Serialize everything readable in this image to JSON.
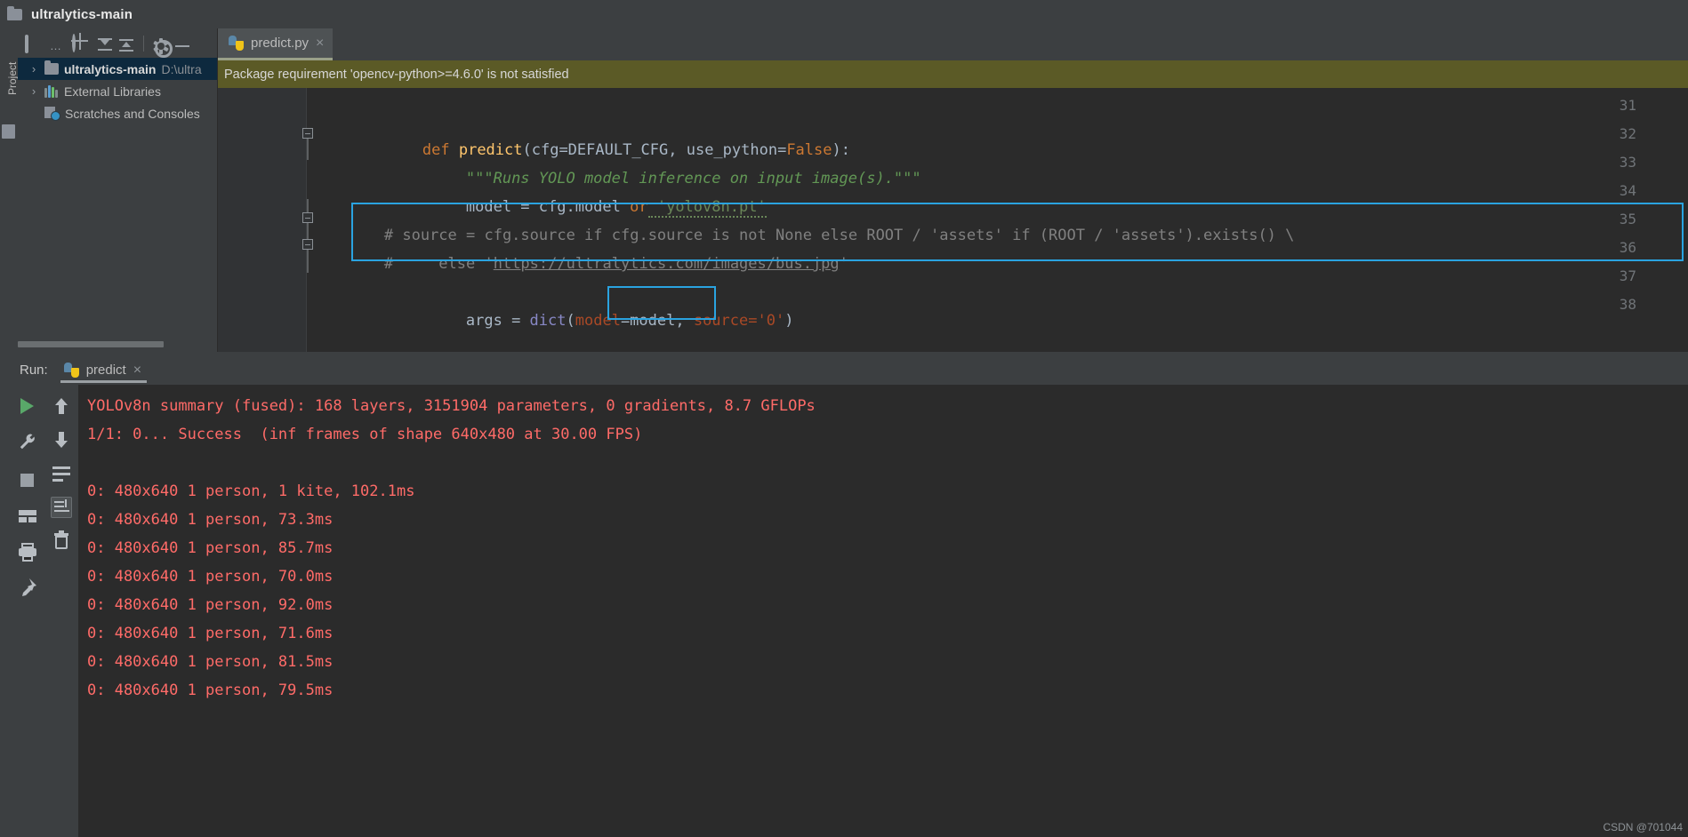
{
  "window": {
    "title": "ultralytics-main",
    "folder_icon": "folder-icon"
  },
  "left_strip": {
    "label": "Project"
  },
  "project_panel": {
    "toolbar": [
      {
        "name": "select-opened-file-icon",
        "label": "…"
      },
      {
        "name": "locate-target-icon",
        "label": ""
      },
      {
        "name": "expand-all-icon",
        "label": ""
      },
      {
        "name": "collapse-all-icon",
        "label": ""
      },
      {
        "name": "settings-gear-icon",
        "label": ""
      },
      {
        "name": "hide-panel-icon",
        "label": ""
      }
    ],
    "tree": [
      {
        "chevron": "›",
        "icon": "folder-icon",
        "label": "ultralytics-main",
        "path": "D:\\ultra",
        "selected": true
      },
      {
        "chevron": "›",
        "icon": "library-icon",
        "label": "External Libraries",
        "path": "",
        "selected": false
      },
      {
        "chevron": "",
        "icon": "scratches-icon",
        "label": "Scratches and Consoles",
        "path": "",
        "selected": false
      }
    ]
  },
  "editor": {
    "tab": {
      "label": "predict.py",
      "icon": "python-file-icon",
      "close": "×"
    },
    "warning": "Package requirement 'opencv-python>=4.6.0' is not satisfied",
    "line_numbers": [
      "31",
      "32",
      "33",
      "34",
      "35",
      "36",
      "37",
      "38"
    ],
    "lines": {
      "l32_def": "def",
      "l32_name": " predict",
      "l32_rest": "(cfg=DEFAULT_CFG, use_python=",
      "l32_false": "False",
      "l32_end": "):",
      "l33": "\"\"\"Runs YOLO model inference on input image(s).\"\"\"",
      "l34_a": "model = cfg.model ",
      "l34_or": "or",
      "l34_str": " 'yolov8n.pt'",
      "l35": "# source = cfg.source if cfg.source is not None else ROOT / 'assets' if (ROOT / 'assets').exists() \\",
      "l36_a": "#     else '",
      "l36_url": "https://ultralytics.com/images/bus.jpg",
      "l36_b": "'",
      "l38_a": "args = ",
      "l38_dict": "dict",
      "l38_b": "(",
      "l38_kw1": "model",
      "l38_c": "=model, ",
      "l38_kw2": "source",
      "l38_d": "='0'",
      "l38_e": ")"
    },
    "highlight_colors": {
      "box": "#2aa3e0"
    }
  },
  "run_panel": {
    "label": "Run:",
    "tab": {
      "label": "predict",
      "icon": "python-run-icon",
      "close": "×"
    },
    "toolbar_left": [
      {
        "name": "rerun-button",
        "icon": "play-icon"
      },
      {
        "name": "edit-configuration-button",
        "icon": "wrench-icon"
      },
      {
        "name": "stop-button",
        "icon": "stop-icon"
      },
      {
        "name": "layout-button",
        "icon": "layout-icon"
      },
      {
        "name": "print-button",
        "icon": "print-icon"
      },
      {
        "name": "pin-tab-button",
        "icon": "pin-icon"
      }
    ],
    "toolbar_second": [
      {
        "name": "prev-occurrence-button",
        "icon": "arrow-up-icon"
      },
      {
        "name": "next-occurrence-button",
        "icon": "arrow-down-icon"
      },
      {
        "name": "soft-wrap-button",
        "icon": "wrap-icon"
      },
      {
        "name": "scroll-to-end-button",
        "icon": "scroll-end-icon"
      },
      {
        "name": "clear-all-button",
        "icon": "trash-icon"
      }
    ],
    "console_lines": [
      "YOLOv8n summary (fused): 168 layers, 3151904 parameters, 0 gradients, 8.7 GFLOPs",
      "1/1: 0... Success  (inf frames of shape 640x480 at 30.00 FPS)",
      "",
      "0: 480x640 1 person, 1 kite, 102.1ms",
      "0: 480x640 1 person, 73.3ms",
      "0: 480x640 1 person, 85.7ms",
      "0: 480x640 1 person, 70.0ms",
      "0: 480x640 1 person, 92.0ms",
      "0: 480x640 1 person, 71.6ms",
      "0: 480x640 1 person, 81.5ms",
      "0: 480x640 1 person, 79.5ms"
    ],
    "console_text_color": "#ff6b68"
  },
  "watermark": "CSDN @701044"
}
